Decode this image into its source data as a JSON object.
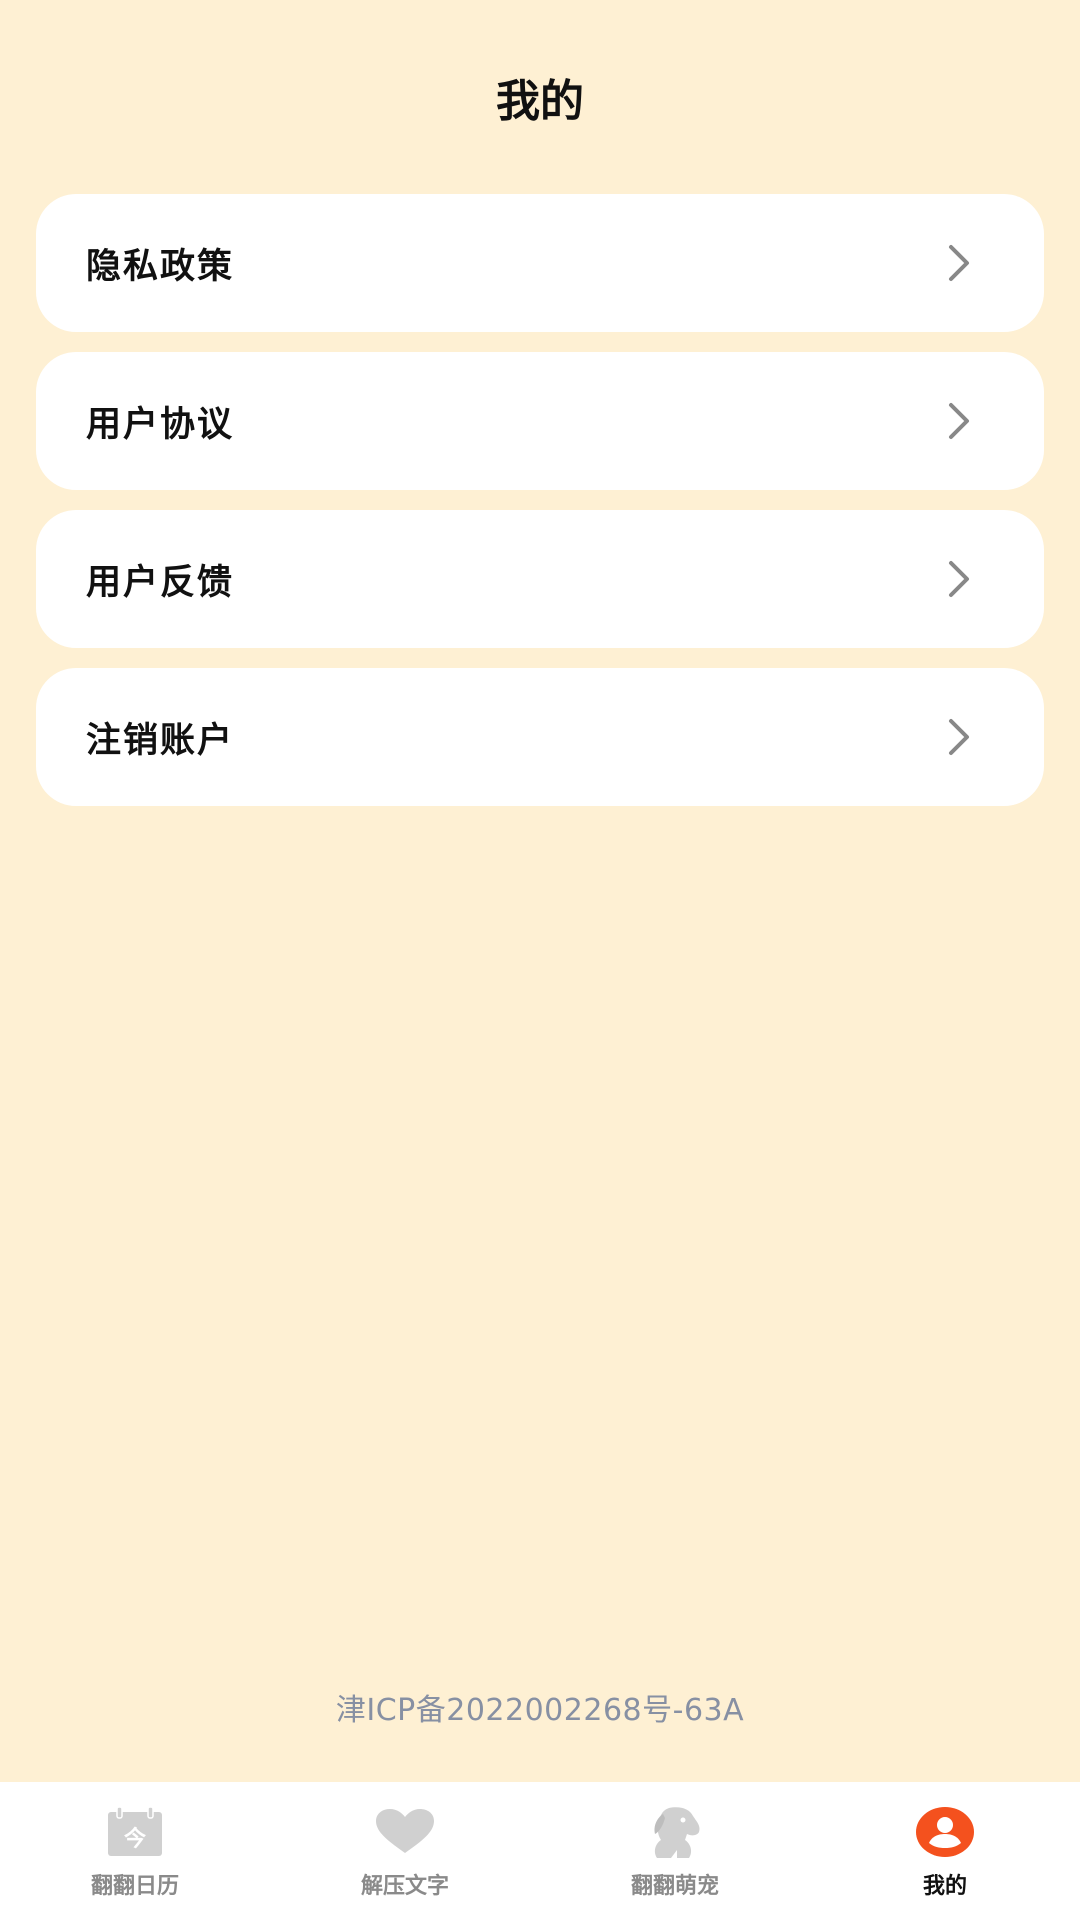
{
  "header": {
    "title": "我的"
  },
  "menu": {
    "items": [
      {
        "label": "隐私政策"
      },
      {
        "label": "用户协议"
      },
      {
        "label": "用户反馈"
      },
      {
        "label": "注销账户"
      }
    ]
  },
  "footer": {
    "icp": "津ICP备2022002268号-63A"
  },
  "tabbar": {
    "tabs": [
      {
        "label": "翻翻日历",
        "icon": "calendar-icon",
        "active": false
      },
      {
        "label": "解压文字",
        "icon": "heart-icon",
        "active": false
      },
      {
        "label": "翻翻萌宠",
        "icon": "dog-icon",
        "active": false
      },
      {
        "label": "我的",
        "icon": "user-icon",
        "active": true
      }
    ],
    "calendar_icon_glyph": "今"
  },
  "colors": {
    "background": "#FEF0D3",
    "card": "#FFFFFF",
    "active_accent": "#F4511E",
    "inactive_icon": "#D0D0D0",
    "icp_text": "#8790A3"
  }
}
